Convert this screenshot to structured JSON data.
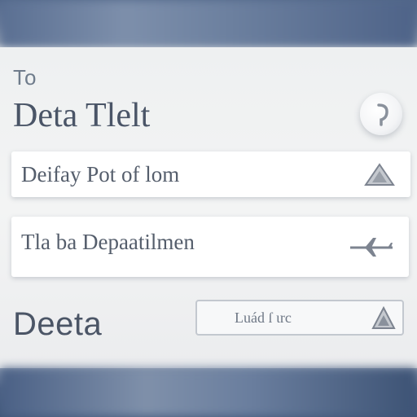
{
  "header": {
    "small_label": "To",
    "title": "Deta Tlelt"
  },
  "fields": [
    {
      "value": "Deifay Pot of lom",
      "icon": "warning-triangle-icon"
    },
    {
      "value": "Tla ba Depaatilmen",
      "icon": "airplane-icon"
    }
  ],
  "footer": {
    "label": "Deeta",
    "input_value": "Luád  ſ  ɩrc",
    "input_icon": "warning-triangle-icon"
  },
  "colors": {
    "background_blue": "#52688a",
    "panel": "#f1f2f3",
    "text_dark": "#4a5567",
    "icon_gray": "#8a919c"
  }
}
